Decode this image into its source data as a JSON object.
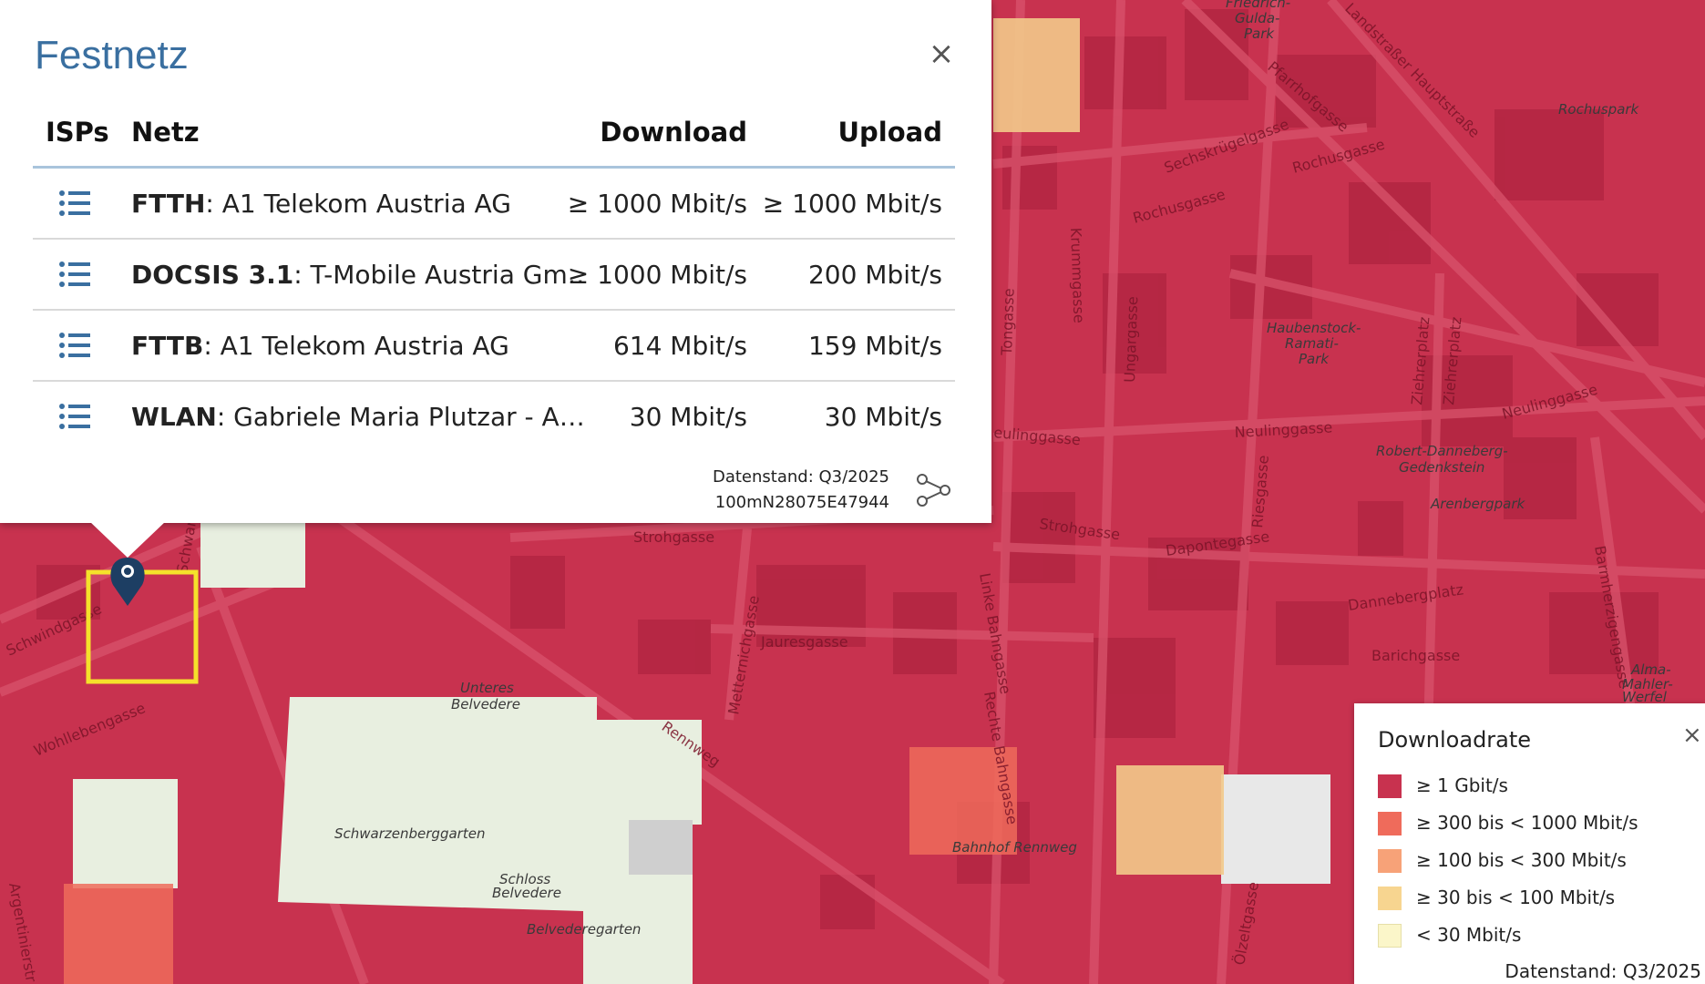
{
  "popup": {
    "title": "Festnetz",
    "close_label": "×",
    "columns": {
      "isps": "ISPs",
      "netz": "Netz",
      "download": "Download",
      "upload": "Upload"
    },
    "rows": [
      {
        "tech": "FTTH",
        "provider": ": A1 Telekom Austria AG",
        "download": "≥ 1000 Mbit/s",
        "upload": "≥ 1000 Mbit/s"
      },
      {
        "tech": "DOCSIS 3.1",
        "provider": ": T-Mobile Austria Gm…",
        "download": "≥ 1000 Mbit/s",
        "upload": "200 Mbit/s"
      },
      {
        "tech": "FTTB",
        "provider": ": A1 Telekom Austria AG",
        "download": "614 Mbit/s",
        "upload": "159 Mbit/s"
      },
      {
        "tech": "WLAN",
        "provider": ": Gabriele Maria Plutzar - A…",
        "download": "30 Mbit/s",
        "upload": "30 Mbit/s"
      }
    ],
    "datenstand": "Datenstand: Q3/2025",
    "cell_id": "100mN28075E47944",
    "share_icon": "share-icon",
    "list_icon": "list-icon"
  },
  "legend": {
    "title": "Downloadrate",
    "close_label": "×",
    "items": [
      {
        "label": "≥ 1 Gbit/s",
        "color": "#c8324f"
      },
      {
        "label": "≥ 300 bis < 1000 Mbit/s",
        "color": "#ef6b5b"
      },
      {
        "label": "≥ 100 bis < 300 Mbit/s",
        "color": "#f7a278"
      },
      {
        "label": "≥ 30 bis < 100 Mbit/s",
        "color": "#f7d590"
      },
      {
        "label": "< 30 Mbit/s",
        "color": "#fbf6c9"
      }
    ],
    "footer": "Datenstand: Q3/2025"
  },
  "map": {
    "streets": [
      "Schwindgasse",
      "Wohllebengasse",
      "Argentinierstr",
      "Strohgasse",
      "Jauresgasse",
      "Metternichgasse",
      "Rennweg",
      "Linke Bahngasse",
      "Rechte Bahngasse",
      "Ungargasse",
      "Tongasse",
      "Krummgasse",
      "Neulinggasse",
      "Daponte­gasse",
      "Dannebergplatz",
      "Barichgasse",
      "Riesgasse",
      "Sechskrügelgasse",
      "Rochusgasse",
      "Pfarrhofgasse",
      "Ziehrerplatz",
      "Barmherzigengasse",
      "Landstraßer Hauptstraße",
      "Schwarzenbergplatz",
      "Ölzeltgasse"
    ],
    "park_labels": [
      "Unteres Belvedere",
      "Schwarzenberggarten",
      "Schloss Belvedere",
      "Belvederegarten",
      "Bahnhof Rennweg",
      "Haubenstock-Ramati-Park",
      "Robert-Danneberg-Gedenkstein",
      "Arenbergpark",
      "Rochuspark",
      "Friedrich-Gulda-Park",
      "Alma-Mahler-Werfel"
    ],
    "marker_icon": "map-pin-icon",
    "colors": {
      "gbit": "#c8324f",
      "park": "#e8efe0",
      "orange": "#ef6b5b",
      "yellow": "#f7d590"
    }
  }
}
